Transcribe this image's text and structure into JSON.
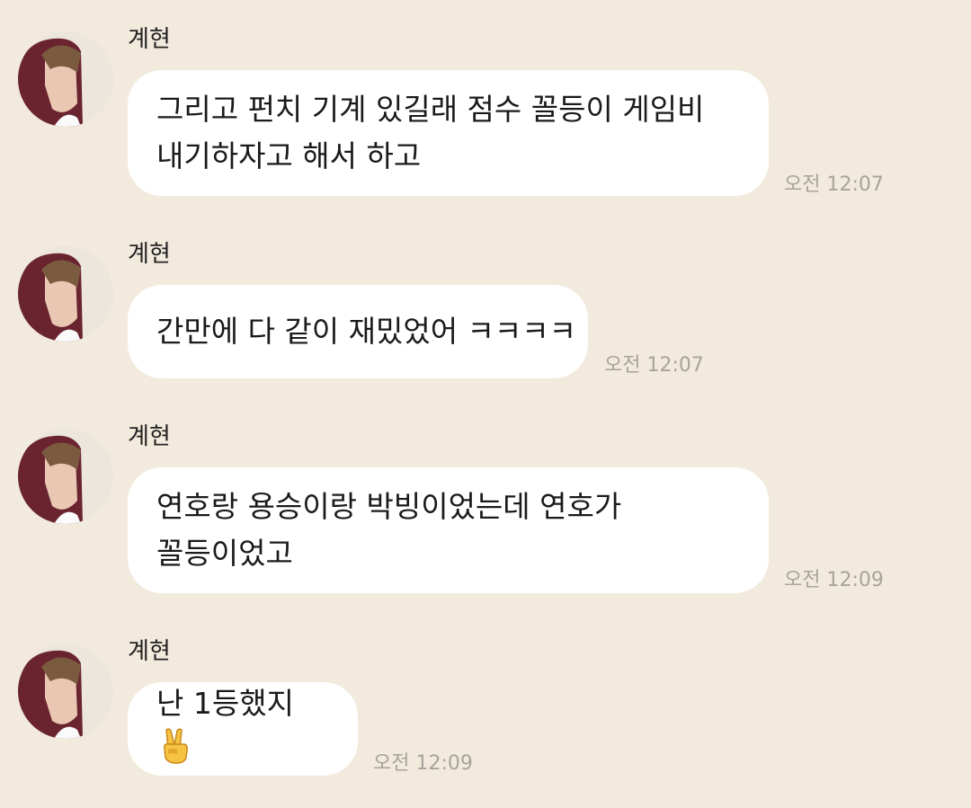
{
  "messages": [
    {
      "sender": "계현",
      "lines": [
        "그리고 펀치 기계 있길래 점수 꼴등이 게임비",
        "내기하자고 해서 하고"
      ],
      "time": "오전 12:07"
    },
    {
      "sender": "계현",
      "lines": [
        "간만에 다 같이 재밌었어 ㅋㅋㅋㅋ"
      ],
      "time": "오전 12:07"
    },
    {
      "sender": "계현",
      "lines": [
        "연호랑 용승이랑 박빙이었는데 연호가",
        "꼴등이었고"
      ],
      "time": "오전 12:09"
    },
    {
      "sender": "계현",
      "lines": [
        "난 1등했지"
      ],
      "emoji": "victory-hand",
      "time": "오전 12:09"
    }
  ]
}
